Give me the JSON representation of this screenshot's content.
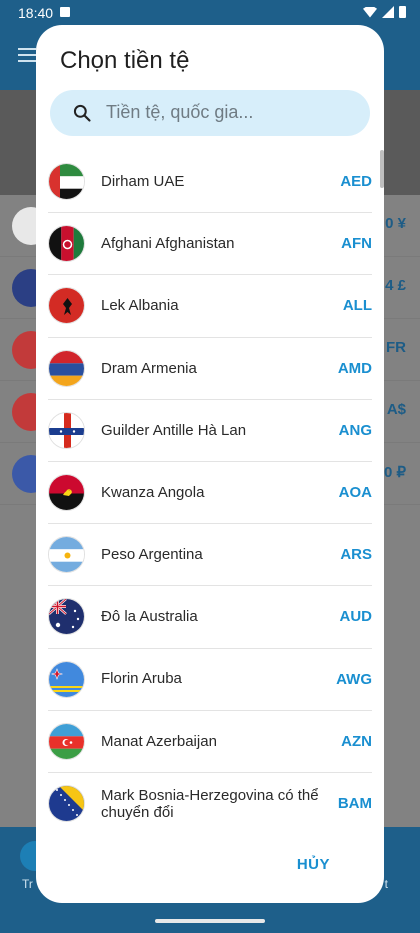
{
  "status": {
    "time": "18:40"
  },
  "background": {
    "rows": [
      {
        "value": "0 ¥",
        "color": "#e8e8e8"
      },
      {
        "value": "4 £",
        "color": "#2b3f84"
      },
      {
        "value": "FR",
        "color": "#c23a3a"
      },
      {
        "value": "A$",
        "color": "#c23a3a"
      },
      {
        "value": "0 ₽",
        "color": "#3b59a8"
      }
    ],
    "tab_left": "Tr",
    "tab_right": "t"
  },
  "dialog": {
    "title": "Chọn tiền tệ",
    "search_placeholder": "Tiền tệ, quốc gia...",
    "cancel_label": "HỦY",
    "currencies": [
      {
        "name": "Dirham UAE",
        "code": "AED",
        "flag": "aed"
      },
      {
        "name": "Afghani Afghanistan",
        "code": "AFN",
        "flag": "afn"
      },
      {
        "name": "Lek Albania",
        "code": "ALL",
        "flag": "all"
      },
      {
        "name": "Dram Armenia",
        "code": "AMD",
        "flag": "amd"
      },
      {
        "name": "Guilder Antille Hà Lan",
        "code": "ANG",
        "flag": "ang"
      },
      {
        "name": "Kwanza Angola",
        "code": "AOA",
        "flag": "aoa"
      },
      {
        "name": "Peso Argentina",
        "code": "ARS",
        "flag": "ars"
      },
      {
        "name": "Đô la Australia",
        "code": "AUD",
        "flag": "aud"
      },
      {
        "name": "Florin Aruba",
        "code": "AWG",
        "flag": "awg"
      },
      {
        "name": "Manat Azerbaijan",
        "code": "AZN",
        "flag": "azn"
      },
      {
        "name": "Mark Bosnia-Herzegovina có thể chuyển đổi",
        "code": "BAM",
        "flag": "bam"
      }
    ]
  }
}
